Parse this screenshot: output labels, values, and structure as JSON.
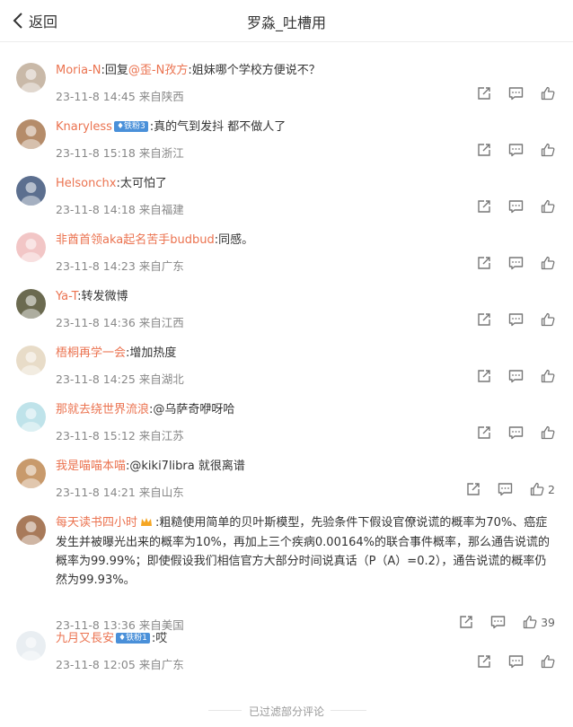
{
  "header": {
    "back_label": "返回",
    "title": "罗淼_吐槽用"
  },
  "comments": [
    {
      "username": "Moria-N",
      "reply_prefix": ":回复",
      "mention": "@歪-N孜方",
      "text": ":姐妹哪个学校方便说不？",
      "time": "23-11-8 14:45",
      "location": "来自陕西",
      "avatar_color": "#c9b9a8"
    },
    {
      "username": "Knaryless",
      "badge": "铁粉3",
      "text": ":真的气到发抖 都不做人了",
      "time": "23-11-8 15:18",
      "location": "来自浙江",
      "avatar_color": "#b58c6a"
    },
    {
      "username": "Helsonchx",
      "text": ":太可怕了",
      "time": "23-11-8 14:18",
      "location": "来自福建",
      "avatar_color": "#5c6f8f"
    },
    {
      "username": "非酋首领aka起名苦手budbud",
      "text": ":同感。",
      "time": "23-11-8 14:23",
      "location": "来自广东",
      "avatar_color": "#f2c6c6"
    },
    {
      "username": "Ya-T",
      "text": ":转发微博",
      "time": "23-11-8 14:36",
      "location": "来自江西",
      "avatar_color": "#6b6a50"
    },
    {
      "username": "梧桐再学一会",
      "text": ":增加热度",
      "time": "23-11-8 14:25",
      "location": "来自湖北",
      "avatar_color": "#e8dcc8"
    },
    {
      "username": "那就去绕世界流浪",
      "text": ":@乌萨奇咿呀哈",
      "time": "23-11-8 15:12",
      "location": "来自江苏",
      "avatar_color": "#bfe3ea"
    },
    {
      "username": "我是喵喵本喵",
      "text": ":@kiki7libra 就很离谱",
      "time": "23-11-8 14:21",
      "location": "来自山东",
      "like_count": "2",
      "avatar_color": "#c89a6c"
    },
    {
      "username": "每天读书四小时",
      "text": ":粗糙使用简单的贝叶斯模型，先验条件下假设官僚说谎的概率为70%、癌症",
      "text_lines": [
        "发生并被曝光出来的概率为10%，再加上三个疾病0.00164%的联合事件概率，那么通告说谎的",
        "概率为99.99%；即使假设我们相信官方大部分时间说真话（P（A）=0.2），通告说谎的概率仍",
        "然为99.93%。"
      ],
      "time": "23-11-8 13:36",
      "location": "来自美国",
      "like_count": "39",
      "avatar_color": "#a87a5a"
    },
    {
      "username": "九月又長安",
      "badge": "铁粉1",
      "text": ":哎",
      "time": "23-11-8 12:05",
      "location": "来自广东",
      "avatar_color": "#e9eef2"
    }
  ],
  "footer": {
    "text": "已过滤部分评论"
  },
  "colors": {
    "username": "#eb7350",
    "meta": "#888888",
    "icon": "#777777"
  },
  "icons": [
    "chevron-left-icon",
    "share-icon",
    "comment-icon",
    "like-icon",
    "crown-icon"
  ]
}
